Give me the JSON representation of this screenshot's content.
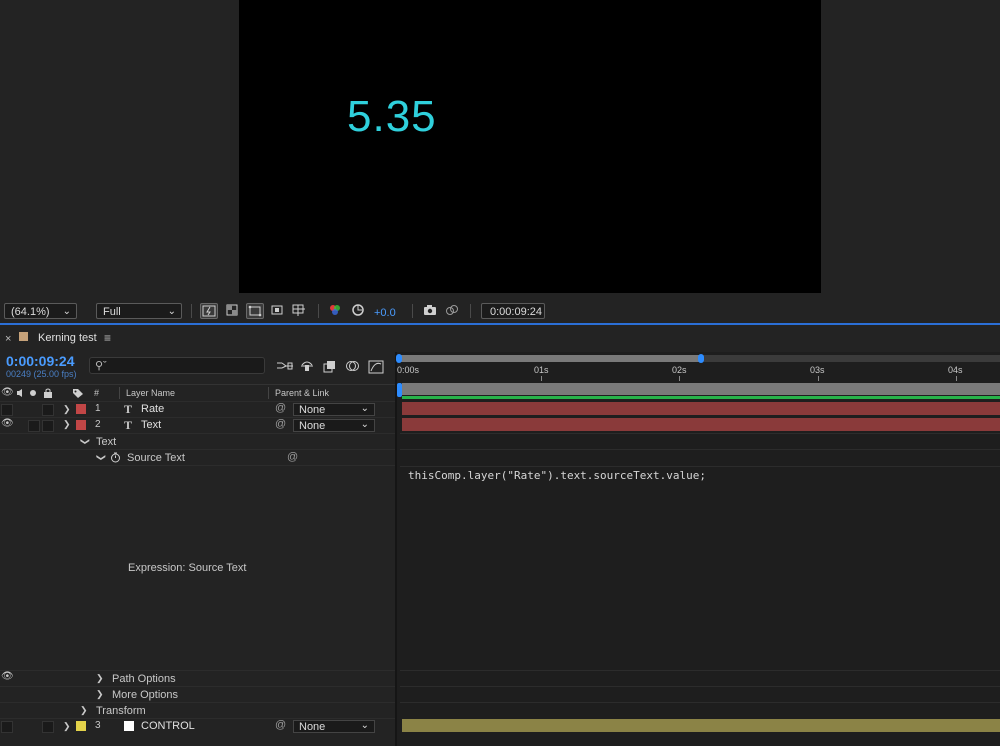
{
  "viewer": {
    "comp_text": "5.35",
    "zoom": "(64.1%)",
    "resolution": "Full",
    "exposure": "+0.0",
    "timecode": "0:00:09:24"
  },
  "timeline": {
    "tab_title": "Kerning test",
    "current_time": "0:00:09:24",
    "frame_info": "00249 (25.00 fps)",
    "search_placeholder": "",
    "columns": {
      "number": "#",
      "layer_name": "Layer Name",
      "parent": "Parent & Link"
    },
    "ruler": [
      "0:00s",
      "01s",
      "02s",
      "03s",
      "04s"
    ],
    "layers": [
      {
        "index": "1",
        "name": "Rate",
        "type": "T",
        "parent": "None",
        "color": "#c14646"
      },
      {
        "index": "2",
        "name": "Text",
        "type": "T",
        "parent": "None",
        "color": "#c14646"
      },
      {
        "index": "3",
        "name": "CONTROL",
        "type": "solid",
        "parent": "None",
        "color": "#e3d24a"
      }
    ],
    "text_group": "Text",
    "source_text": "Source Text",
    "expression_label": "Expression: Source Text",
    "expression_code": "thisComp.layer(\"Rate\").text.sourceText.value;",
    "path_options": "Path Options",
    "more_options": "More Options",
    "transform": "Transform"
  },
  "colors": {
    "accent": "#2b6fd6",
    "comp_text": "#2fd0dc",
    "layer_bar_red": "#8a3a3a",
    "layer_bar_yellow": "#8b8346",
    "work_area": "#7a7a7a",
    "green_line": "#27b34a"
  }
}
